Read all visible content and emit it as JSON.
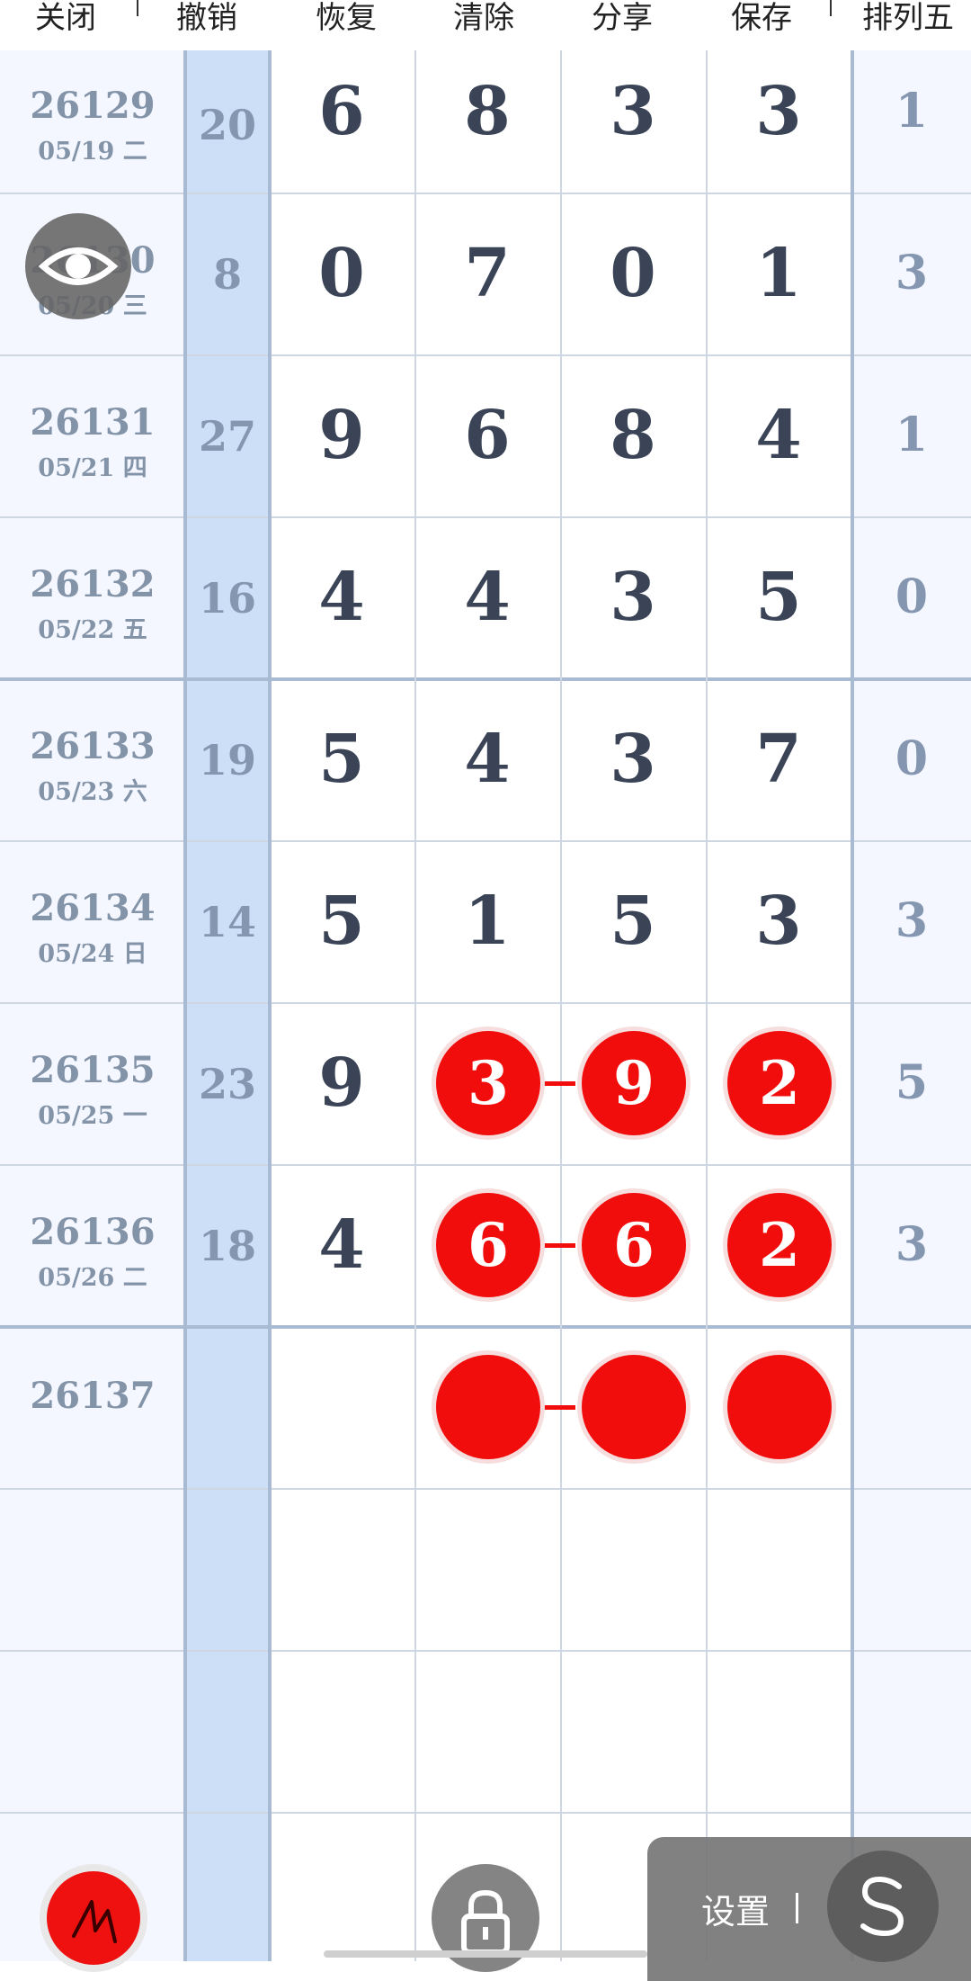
{
  "toolbar": {
    "close": "关闭",
    "undo": "撤销",
    "redo": "恢复",
    "clear": "清除",
    "share": "分享",
    "save": "保存",
    "rank": "排列五"
  },
  "rows": [
    {
      "issue": "26129",
      "date": "05/19 二",
      "sum": "20",
      "d1": "6",
      "d2": "8",
      "d3": "3",
      "d4": "3",
      "p5": "1"
    },
    {
      "issue": "26130",
      "date": "05/20 三",
      "sum": "8",
      "d1": "0",
      "d2": "7",
      "d3": "0",
      "d4": "1",
      "p5": "3"
    },
    {
      "issue": "26131",
      "date": "05/21 四",
      "sum": "27",
      "d1": "9",
      "d2": "6",
      "d3": "8",
      "d4": "4",
      "p5": "1"
    },
    {
      "issue": "26132",
      "date": "05/22 五",
      "sum": "16",
      "d1": "4",
      "d2": "4",
      "d3": "3",
      "d4": "5",
      "p5": "0"
    },
    {
      "issue": "26133",
      "date": "05/23 六",
      "sum": "19",
      "d1": "5",
      "d2": "4",
      "d3": "3",
      "d4": "7",
      "p5": "0"
    },
    {
      "issue": "26134",
      "date": "05/24 日",
      "sum": "14",
      "d1": "5",
      "d2": "1",
      "d3": "5",
      "d4": "3",
      "p5": "3"
    },
    {
      "issue": "26135",
      "date": "05/25 一",
      "sum": "23",
      "d1": "9",
      "b1": "3",
      "b2": "9",
      "b3": "2",
      "p5": "5"
    },
    {
      "issue": "26136",
      "date": "05/26 二",
      "sum": "18",
      "d1": "4",
      "b1": "6",
      "b2": "6",
      "b3": "2",
      "p5": "3"
    },
    {
      "issue": "26137"
    }
  ],
  "settings": {
    "label": "设置"
  },
  "icons": {
    "eye": "eye-icon",
    "pen": "pen-icon",
    "lock": "lock-icon",
    "settings": "s-logo-icon"
  },
  "colors": {
    "ball": "#f20d0d",
    "sum_column": "#ccdff7",
    "digit_text": "#3a4456",
    "muted_text": "#8597b0"
  }
}
